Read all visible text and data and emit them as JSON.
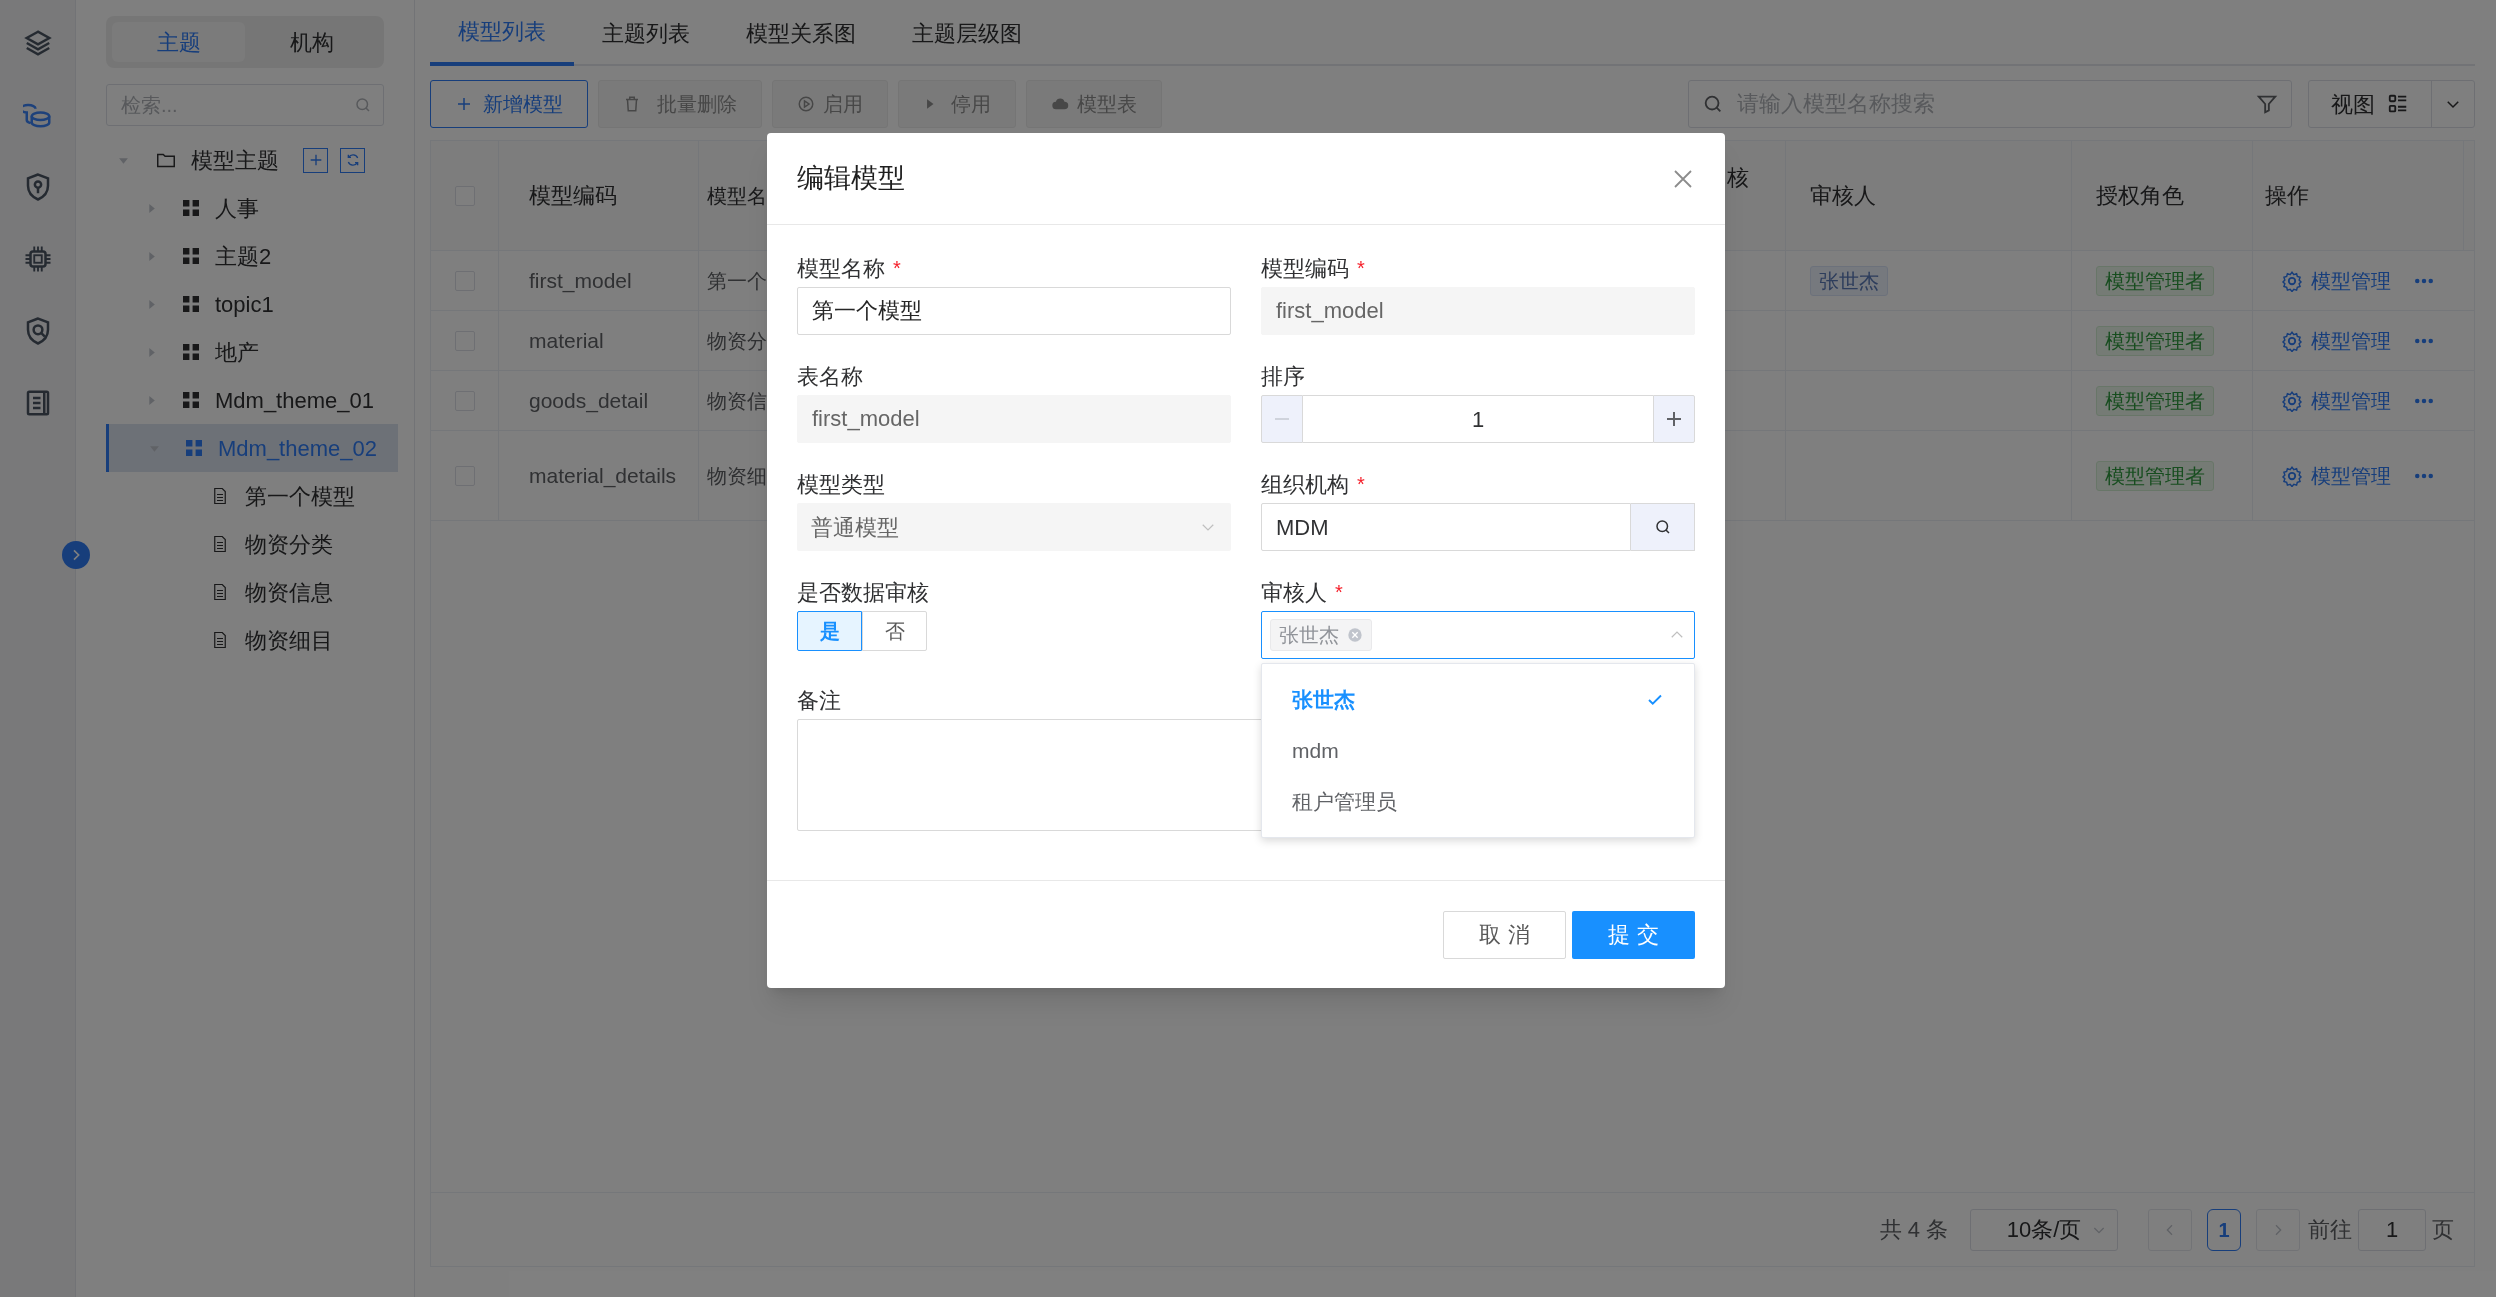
{
  "rail": [
    {
      "kind": "layers",
      "selected": false
    },
    {
      "kind": "coins",
      "selected": true
    },
    {
      "kind": "shieldkey",
      "selected": false
    },
    {
      "kind": "chip",
      "selected": false
    },
    {
      "kind": "shieldsearch",
      "selected": false
    },
    {
      "kind": "document",
      "selected": false
    }
  ],
  "tree_panel": {
    "tabs": [
      {
        "label": "主题",
        "selected": true
      },
      {
        "label": "机构",
        "selected": false
      }
    ],
    "search": {
      "placeholder": "检索..."
    },
    "tree": {
      "label": "模型主题",
      "expanded": true,
      "children": [
        {
          "label": "人事",
          "expanded": false,
          "selected": false
        },
        {
          "label": "主题2",
          "expanded": false,
          "selected": false
        },
        {
          "label": "topic1",
          "expanded": false,
          "selected": false
        },
        {
          "label": "地产",
          "expanded": false,
          "selected": false
        },
        {
          "label": "Mdm_theme_01",
          "expanded": false,
          "selected": false
        },
        {
          "label": "Mdm_theme_02",
          "expanded": true,
          "selected": true,
          "children": [
            {
              "label": "第一个模型"
            },
            {
              "label": "物资分类"
            },
            {
              "label": "物资信息"
            },
            {
              "label": "物资细目"
            }
          ]
        }
      ]
    }
  },
  "tabs": [
    {
      "label": "模型列表",
      "selected": true
    },
    {
      "label": "主题列表",
      "selected": false
    },
    {
      "label": "模型关系图",
      "selected": false
    },
    {
      "label": "主题层级图",
      "selected": false
    }
  ],
  "toolbar": {
    "buttons": [
      {
        "kind": "add",
        "label": "新增模型",
        "disabled": false
      },
      {
        "kind": "delete",
        "label": "批量删除",
        "disabled": true
      },
      {
        "kind": "enable",
        "label": "启用",
        "disabled": true
      },
      {
        "kind": "disable",
        "label": "停用",
        "disabled": true
      },
      {
        "kind": "upload",
        "label": "模型表",
        "disabled": true
      }
    ],
    "search": {
      "placeholder": "请输入模型名称搜索"
    },
    "view_button": "视图"
  },
  "table": {
    "header_checked": false,
    "columns": [
      "模型编码",
      "模型名",
      "核",
      "审核人",
      "授权角色",
      "操作"
    ],
    "rows": [
      {
        "checked": false,
        "code": "first_model",
        "name": "第一个",
        "reviewer": "张世杰",
        "role": "模型管理者",
        "action": "模型管理"
      },
      {
        "checked": false,
        "code": "material",
        "name": "物资分",
        "role": "模型管理者",
        "action": "模型管理"
      },
      {
        "checked": false,
        "code": "goods_detail",
        "name": "物资信",
        "role": "模型管理者",
        "action": "模型管理"
      },
      {
        "checked": false,
        "code": "material_details",
        "name": "物资细",
        "role": "模型管理者",
        "action": "模型管理"
      }
    ]
  },
  "pagination": {
    "total": "共 4 条",
    "page_size": "10条/页",
    "pages": [
      {
        "label": "1",
        "selected": true
      }
    ],
    "goto_label": "前往",
    "goto_value": "1",
    "page_suffix": "页"
  },
  "dialog": {
    "title": "编辑模型",
    "fields": [
      {
        "kind": "text",
        "label": "模型名称",
        "required_mark": "*",
        "value": "第一个模型",
        "disabled": false
      },
      {
        "kind": "text",
        "label": "模型编码",
        "required_mark": "*",
        "value": "first_model",
        "disabled": true
      },
      {
        "kind": "text",
        "label": "表名称",
        "value": "first_model",
        "disabled": true
      },
      {
        "kind": "number",
        "label": "排序",
        "value": "1",
        "decrement_disabled": true
      },
      {
        "kind": "select",
        "label": "模型类型",
        "value": "普通模型",
        "disabled": true
      },
      {
        "kind": "lookup",
        "label": "组织机构",
        "required_mark": "*",
        "value": "MDM"
      },
      {
        "kind": "toggle",
        "label": "是否数据审核",
        "options": [
          {
            "label": "是",
            "selected": true
          },
          {
            "label": "否",
            "selected": false
          }
        ]
      },
      {
        "kind": "multiselect",
        "label": "审核人",
        "required_mark": "*",
        "tags": [
          "张世杰"
        ],
        "expanded": true
      },
      {
        "kind": "textarea",
        "label": "备注"
      }
    ],
    "dropdown": {
      "options": [
        {
          "label": "张世杰",
          "selected": true
        },
        {
          "label": "mdm",
          "selected": false
        },
        {
          "label": "租户管理员",
          "selected": false
        }
      ]
    },
    "buttons": [
      {
        "label": "取 消",
        "primary": false
      },
      {
        "label": "提 交",
        "primary": true
      }
    ]
  }
}
